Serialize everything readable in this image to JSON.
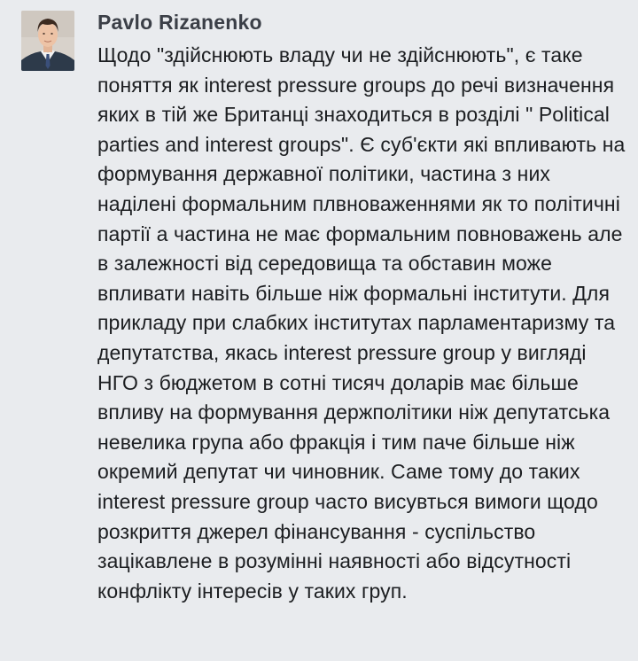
{
  "comment": {
    "author": "Pavlo Rizanenko",
    "text": "Щодо \"здійснюють владу чи не здійснюють\",  є таке поняття як interest pressure groups до речі визначення яких в тій же Британці знаходиться в розділі \"  Political parties and interest groups\". Є суб'єкти які впливають на формування державної політики, частина з них наділені формальним плвноваженнями як то політичні партії а частина не має формальним повноважень але в залежності від середовища та обставин може впливати навіть більше ніж формальні інститути. Для прикладу при слабких інститутах парламентаризму та депутатства, якась interest pressure group у вигляді НГО з бюджетом в сотні тисяч доларів має більше впливу на формування держполітики ніж депутатська невелика група або фракція і тим паче більше ніж окремий депутат чи чиновник. Саме тому до таких interest pressure group часто висувться вимоги щодо розкриття джерел фінансування - суспільство зацікавлене в розумінні наявності або відсутності конфлікту інтересів у таких груп."
  },
  "colors": {
    "background": "#e9ebee",
    "author": "#3b3f47",
    "text": "#1c1e21"
  }
}
